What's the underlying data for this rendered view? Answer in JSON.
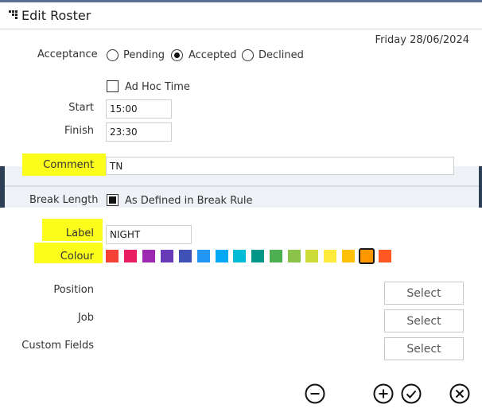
{
  "window": {
    "title": "Edit Roster"
  },
  "date": "Friday 28/06/2024",
  "acceptance": {
    "label": "Acceptance",
    "options": [
      "Pending",
      "Accepted",
      "Declined"
    ],
    "selected": "Accepted"
  },
  "adhoc": {
    "label": "Ad Hoc Time",
    "checked": false
  },
  "start": {
    "label": "Start",
    "value": "15:00"
  },
  "finish": {
    "label": "Finish",
    "value": "23:30"
  },
  "comment": {
    "label": "Comment",
    "value": "TN"
  },
  "break_length": {
    "label": "Break Length",
    "option_label": "As Defined in Break Rule",
    "checked": true
  },
  "roster_label": {
    "label": "Label",
    "value": "NIGHT"
  },
  "colour": {
    "label": "Colour",
    "swatches": [
      "#f44336",
      "#e91e63",
      "#9c27b0",
      "#673ab7",
      "#3f51b5",
      "#2196f3",
      "#03a9f4",
      "#00bcd4",
      "#009688",
      "#4caf50",
      "#8bc34a",
      "#cddc39",
      "#ffeb3b",
      "#ffc107",
      "#ff9800",
      "#ff5722"
    ],
    "selected_index": 14
  },
  "position": {
    "label": "Position",
    "button": "Select"
  },
  "job": {
    "label": "Job",
    "button": "Select"
  },
  "custom_fields": {
    "label": "Custom Fields",
    "button": "Select"
  },
  "highlight_color": "#fbfd1b",
  "actions": [
    "minus-circle-icon",
    "plus-circle-icon",
    "check-circle-icon",
    "close-circle-icon"
  ]
}
